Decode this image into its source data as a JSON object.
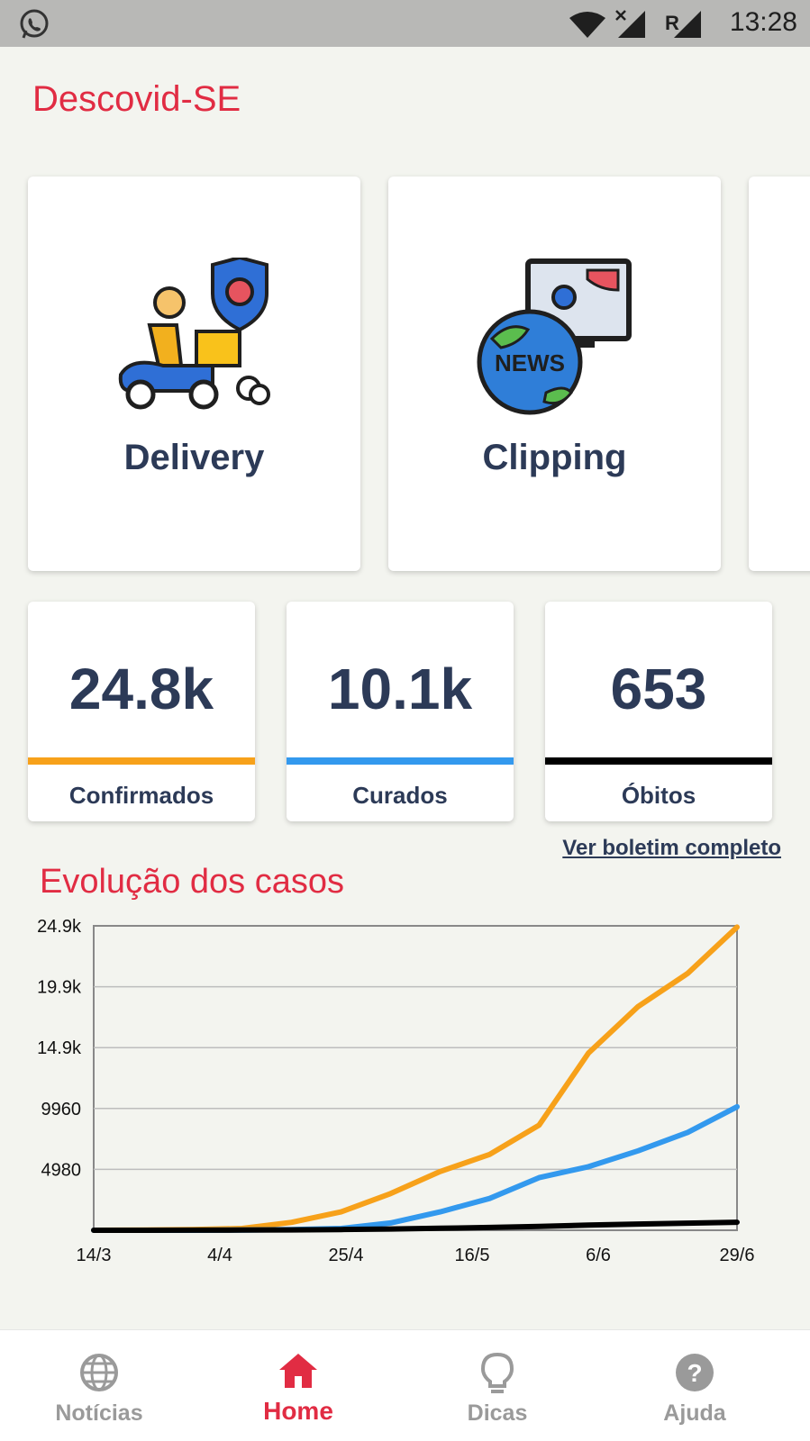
{
  "status_bar": {
    "time": "13:28",
    "carrier_letter": "R"
  },
  "app": {
    "title": "Descovid-SE"
  },
  "feature_cards": [
    {
      "label": "Delivery",
      "icon": "delivery-scooter-icon"
    },
    {
      "label": "Clipping",
      "icon": "news-globe-icon"
    }
  ],
  "stats": [
    {
      "value": "24.8k",
      "label": "Confirmados",
      "color": "#f7a11a"
    },
    {
      "value": "10.1k",
      "label": "Curados",
      "color": "#3399ee"
    },
    {
      "value": "653",
      "label": "Óbitos",
      "color": "#000000"
    }
  ],
  "bulletin_link": "Ver boletim completo",
  "chart_section_title": "Evolução dos casos",
  "chart_data": {
    "type": "line",
    "title": "",
    "xlabel": "",
    "ylabel": "",
    "x_tick_labels": [
      "14/3",
      "4/4",
      "25/4",
      "16/5",
      "6/6",
      "29/6"
    ],
    "y_tick_labels": [
      "24.9k",
      "19.9k",
      "14.9k",
      "9960",
      "4980"
    ],
    "ylim": [
      0,
      24900
    ],
    "grid": true,
    "x_dates": [
      "14/3",
      "28/3",
      "11/4",
      "25/4",
      "2/5",
      "9/5",
      "16/5",
      "23/5",
      "30/5",
      "6/6",
      "13/6",
      "20/6",
      "25/6",
      "29/6"
    ],
    "series": [
      {
        "color": "#f7a11a",
        "values": [
          0,
          20,
          60,
          150,
          650,
          1500,
          3000,
          4800,
          6200,
          8600,
          14500,
          18300,
          21000,
          24800
        ]
      },
      {
        "color": "#3399ee",
        "values": [
          0,
          0,
          0,
          20,
          60,
          150,
          600,
          1500,
          2600,
          4300,
          5200,
          6500,
          8000,
          10100
        ]
      },
      {
        "color": "#000000",
        "values": [
          0,
          0,
          5,
          15,
          30,
          60,
          100,
          160,
          230,
          320,
          420,
          510,
          580,
          653
        ]
      }
    ]
  },
  "bottom_nav": [
    {
      "label": "Notícias",
      "icon": "globe-icon"
    },
    {
      "label": "Home",
      "icon": "home-icon"
    },
    {
      "label": "Dicas",
      "icon": "lightbulb-icon"
    },
    {
      "label": "Ajuda",
      "icon": "help-icon"
    }
  ],
  "colors": {
    "brand_red": "#e12c43",
    "navy": "#2c3a57",
    "inactive_gray": "#9a9a9a"
  }
}
